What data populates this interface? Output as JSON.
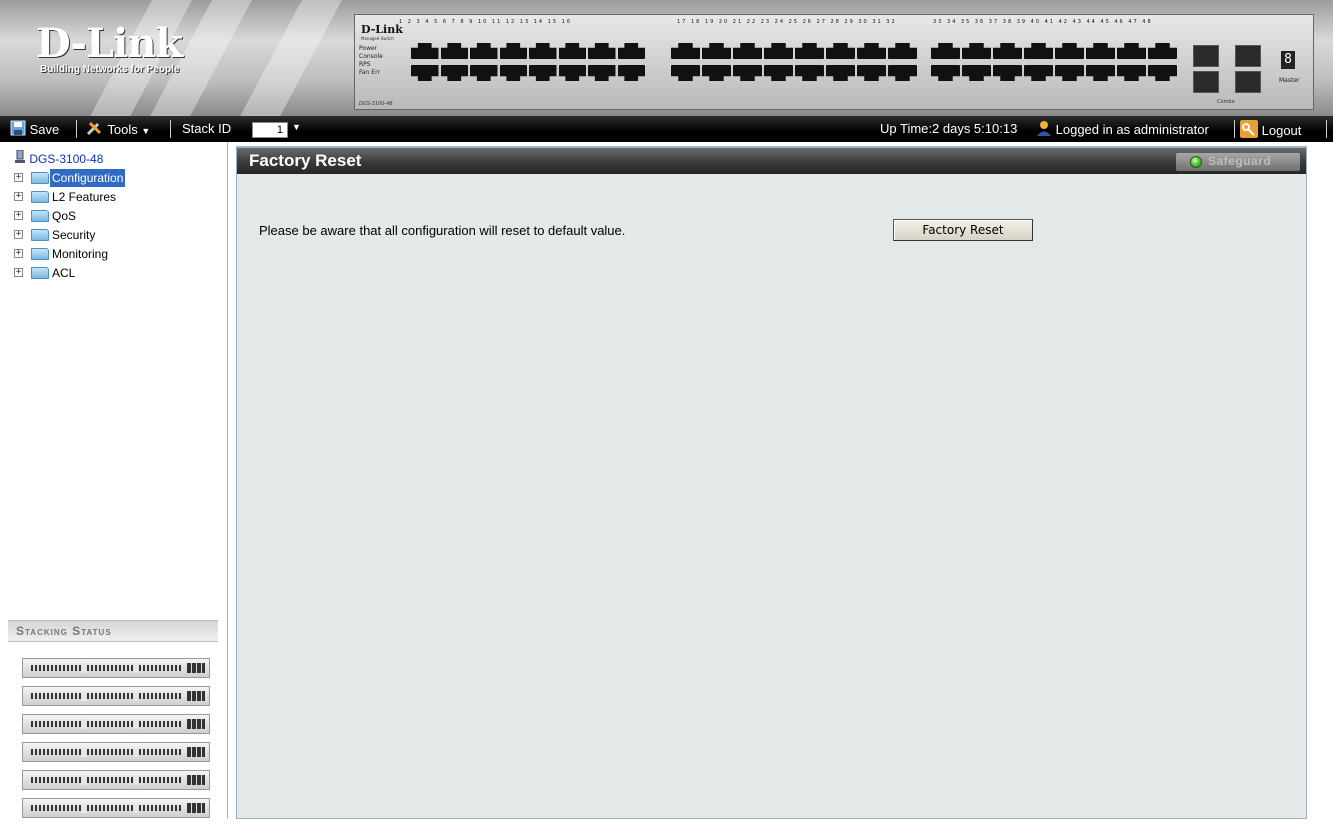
{
  "brand": {
    "logo": "D-Link",
    "tagline": "Building Networks for People"
  },
  "device": {
    "brand": "D-Link",
    "subtitle": "Managed Switch",
    "leds": [
      "Power",
      "Console",
      "RPS",
      "Fan Err"
    ],
    "model": "DGS-3100-48",
    "port_numbers_1": "1 2 3 4 5 6 7 8 9 10 11 12 13 14 15 16",
    "port_numbers_2": "17 18 19 20 21 22 23 24 25 26 27 28 29 30 31 32",
    "port_numbers_3": "33 34 35 36 37 38 39 40 41 42 43 44 45 46 47 48",
    "combo_label": "Combo",
    "master_label": "Master",
    "unit_display": "8"
  },
  "toolbar": {
    "save_label": "Save",
    "tools_label": "Tools",
    "stack_id_label": "Stack ID",
    "stack_id_value": "1",
    "uptime": "Up Time:2 days 5:10:13",
    "logged_in": "Logged in as administrator",
    "logout_label": "Logout"
  },
  "tree": {
    "root": "DGS-3100-48",
    "items": [
      {
        "label": "Configuration",
        "selected": true
      },
      {
        "label": "L2 Features",
        "selected": false
      },
      {
        "label": "QoS",
        "selected": false
      },
      {
        "label": "Security",
        "selected": false
      },
      {
        "label": "Monitoring",
        "selected": false
      },
      {
        "label": "ACL",
        "selected": false
      }
    ]
  },
  "stacking": {
    "title": "Stacking Status",
    "unit_count": 6
  },
  "main": {
    "title": "Factory Reset",
    "safeguard": "Safeguard",
    "notice": "Please be aware that all configuration will reset to default value.",
    "reset_button": "Factory Reset"
  },
  "colors": {
    "panel_bg": "#e2e9e8",
    "selection": "#316ac5",
    "tree_root": "#1232b8",
    "safeguard_led": "#5cd33c"
  }
}
